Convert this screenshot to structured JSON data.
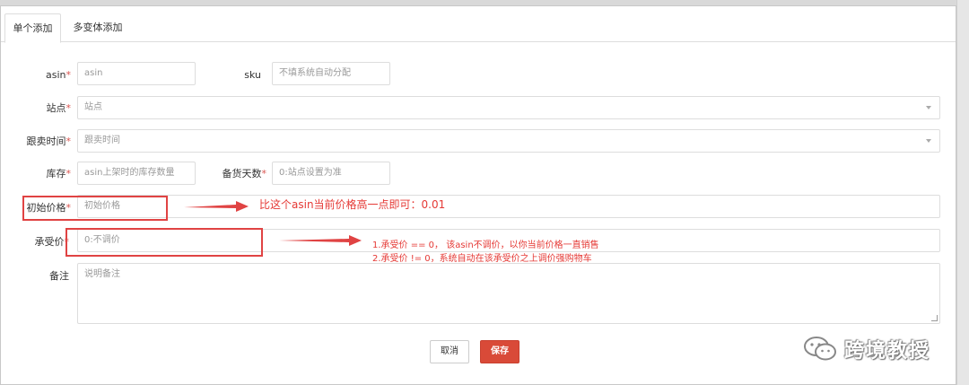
{
  "tabs": [
    {
      "label": "单个添加",
      "active": true
    },
    {
      "label": "多变体添加",
      "active": false
    }
  ],
  "form": {
    "asin": {
      "label": "asin",
      "placeholder": "asin"
    },
    "sku": {
      "label": "sku",
      "placeholder": "不填系统自动分配"
    },
    "site": {
      "label": "站点",
      "placeholder": "站点"
    },
    "follow_time": {
      "label": "跟卖时间",
      "placeholder": "跟卖时间"
    },
    "stock": {
      "label": "库存",
      "placeholder": "asin上架时的库存数量"
    },
    "stock_days": {
      "label": "备货天数",
      "placeholder": "0:站点设置为准"
    },
    "initial_price": {
      "label": "初始价格",
      "placeholder": "初始价格"
    },
    "min_price": {
      "label": "承受价",
      "placeholder": "0:不调价"
    },
    "remark": {
      "label": "备注",
      "placeholder": "说明备注"
    },
    "required_mark": "*"
  },
  "annotations": {
    "initial_price_note": "比这个asin当前价格高一点即可：0.01",
    "min_price_note_1": "1.承受价 == 0， 该asin不调价，以你当前价格一直销售",
    "min_price_note_2": "2.承受价 != 0，系统自动在该承受价之上调价强购物车",
    "highlight_color": "#e04343"
  },
  "buttons": {
    "cancel": "取消",
    "save": "保存",
    "save_color": "#d94a38"
  },
  "watermark": {
    "text": "跨境教授",
    "icon": "wechat-icon"
  }
}
